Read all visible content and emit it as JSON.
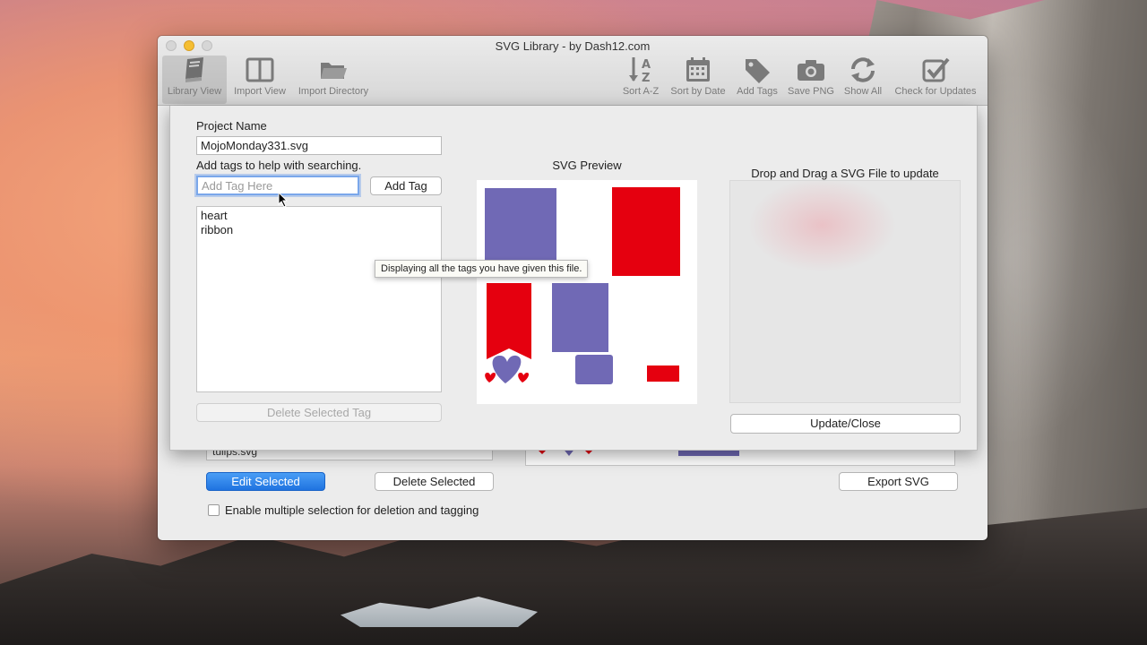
{
  "window": {
    "title": "SVG Library - by Dash12.com"
  },
  "toolbar": {
    "left": [
      {
        "label": "Library View",
        "icon": "book-icon",
        "active": true
      },
      {
        "label": "Import View",
        "icon": "split-view-icon",
        "active": false
      },
      {
        "label": "Import Directory",
        "icon": "folder-icon",
        "active": false
      }
    ],
    "right": [
      {
        "label": "Sort A-Z",
        "icon": "sort-az-icon"
      },
      {
        "label": "Sort by Date",
        "icon": "calendar-icon"
      },
      {
        "label": "Add Tags",
        "icon": "tag-icon"
      },
      {
        "label": "Save PNG",
        "icon": "camera-icon"
      },
      {
        "label": "Show All",
        "icon": "refresh-icon"
      },
      {
        "label": "Check for Updates",
        "icon": "checkbox-icon"
      }
    ]
  },
  "sheet": {
    "project_name_label": "Project Name",
    "project_name_value": "MojoMonday331.svg",
    "tags_hint": "Add tags to help with searching.",
    "tag_input_placeholder": "Add Tag Here",
    "add_tag_label": "Add Tag",
    "tags": [
      "heart",
      "ribbon"
    ],
    "delete_tag_label": "Delete Selected Tag",
    "preview_title": "SVG Preview",
    "drop_title": "Drop and Drag a SVG File to update",
    "update_close_label": "Update/Close",
    "tooltip": "Displaying all the tags you have given this file."
  },
  "library": {
    "file_row": "tulips.svg",
    "edit_selected_label": "Edit Selected",
    "delete_selected_label": "Delete Selected",
    "export_label": "Export SVG",
    "multi_select_label": "Enable multiple selection for deletion and tagging"
  },
  "colors": {
    "purple": "#7069b5",
    "red": "#e5000f",
    "accent": "#2a7ff0"
  }
}
